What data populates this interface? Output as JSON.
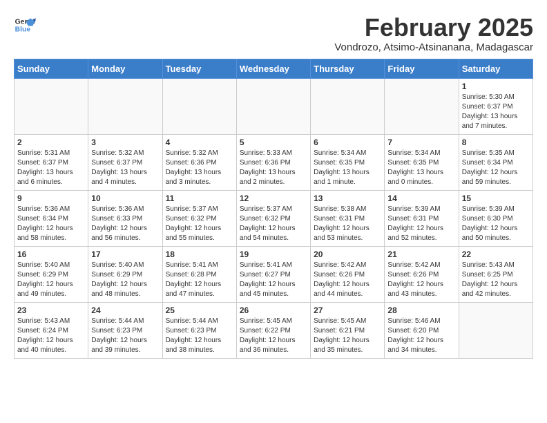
{
  "header": {
    "logo_line1": "General",
    "logo_line2": "Blue",
    "title": "February 2025",
    "subtitle": "Vondrozo, Atsimo-Atsinanana, Madagascar"
  },
  "days_of_week": [
    "Sunday",
    "Monday",
    "Tuesday",
    "Wednesday",
    "Thursday",
    "Friday",
    "Saturday"
  ],
  "weeks": [
    [
      {
        "day": "",
        "info": ""
      },
      {
        "day": "",
        "info": ""
      },
      {
        "day": "",
        "info": ""
      },
      {
        "day": "",
        "info": ""
      },
      {
        "day": "",
        "info": ""
      },
      {
        "day": "",
        "info": ""
      },
      {
        "day": "1",
        "info": "Sunrise: 5:30 AM\nSunset: 6:37 PM\nDaylight: 13 hours\nand 7 minutes."
      }
    ],
    [
      {
        "day": "2",
        "info": "Sunrise: 5:31 AM\nSunset: 6:37 PM\nDaylight: 13 hours\nand 6 minutes."
      },
      {
        "day": "3",
        "info": "Sunrise: 5:32 AM\nSunset: 6:37 PM\nDaylight: 13 hours\nand 4 minutes."
      },
      {
        "day": "4",
        "info": "Sunrise: 5:32 AM\nSunset: 6:36 PM\nDaylight: 13 hours\nand 3 minutes."
      },
      {
        "day": "5",
        "info": "Sunrise: 5:33 AM\nSunset: 6:36 PM\nDaylight: 13 hours\nand 2 minutes."
      },
      {
        "day": "6",
        "info": "Sunrise: 5:34 AM\nSunset: 6:35 PM\nDaylight: 13 hours\nand 1 minute."
      },
      {
        "day": "7",
        "info": "Sunrise: 5:34 AM\nSunset: 6:35 PM\nDaylight: 13 hours\nand 0 minutes."
      },
      {
        "day": "8",
        "info": "Sunrise: 5:35 AM\nSunset: 6:34 PM\nDaylight: 12 hours\nand 59 minutes."
      }
    ],
    [
      {
        "day": "9",
        "info": "Sunrise: 5:36 AM\nSunset: 6:34 PM\nDaylight: 12 hours\nand 58 minutes."
      },
      {
        "day": "10",
        "info": "Sunrise: 5:36 AM\nSunset: 6:33 PM\nDaylight: 12 hours\nand 56 minutes."
      },
      {
        "day": "11",
        "info": "Sunrise: 5:37 AM\nSunset: 6:32 PM\nDaylight: 12 hours\nand 55 minutes."
      },
      {
        "day": "12",
        "info": "Sunrise: 5:37 AM\nSunset: 6:32 PM\nDaylight: 12 hours\nand 54 minutes."
      },
      {
        "day": "13",
        "info": "Sunrise: 5:38 AM\nSunset: 6:31 PM\nDaylight: 12 hours\nand 53 minutes."
      },
      {
        "day": "14",
        "info": "Sunrise: 5:39 AM\nSunset: 6:31 PM\nDaylight: 12 hours\nand 52 minutes."
      },
      {
        "day": "15",
        "info": "Sunrise: 5:39 AM\nSunset: 6:30 PM\nDaylight: 12 hours\nand 50 minutes."
      }
    ],
    [
      {
        "day": "16",
        "info": "Sunrise: 5:40 AM\nSunset: 6:29 PM\nDaylight: 12 hours\nand 49 minutes."
      },
      {
        "day": "17",
        "info": "Sunrise: 5:40 AM\nSunset: 6:29 PM\nDaylight: 12 hours\nand 48 minutes."
      },
      {
        "day": "18",
        "info": "Sunrise: 5:41 AM\nSunset: 6:28 PM\nDaylight: 12 hours\nand 47 minutes."
      },
      {
        "day": "19",
        "info": "Sunrise: 5:41 AM\nSunset: 6:27 PM\nDaylight: 12 hours\nand 45 minutes."
      },
      {
        "day": "20",
        "info": "Sunrise: 5:42 AM\nSunset: 6:26 PM\nDaylight: 12 hours\nand 44 minutes."
      },
      {
        "day": "21",
        "info": "Sunrise: 5:42 AM\nSunset: 6:26 PM\nDaylight: 12 hours\nand 43 minutes."
      },
      {
        "day": "22",
        "info": "Sunrise: 5:43 AM\nSunset: 6:25 PM\nDaylight: 12 hours\nand 42 minutes."
      }
    ],
    [
      {
        "day": "23",
        "info": "Sunrise: 5:43 AM\nSunset: 6:24 PM\nDaylight: 12 hours\nand 40 minutes."
      },
      {
        "day": "24",
        "info": "Sunrise: 5:44 AM\nSunset: 6:23 PM\nDaylight: 12 hours\nand 39 minutes."
      },
      {
        "day": "25",
        "info": "Sunrise: 5:44 AM\nSunset: 6:23 PM\nDaylight: 12 hours\nand 38 minutes."
      },
      {
        "day": "26",
        "info": "Sunrise: 5:45 AM\nSunset: 6:22 PM\nDaylight: 12 hours\nand 36 minutes."
      },
      {
        "day": "27",
        "info": "Sunrise: 5:45 AM\nSunset: 6:21 PM\nDaylight: 12 hours\nand 35 minutes."
      },
      {
        "day": "28",
        "info": "Sunrise: 5:46 AM\nSunset: 6:20 PM\nDaylight: 12 hours\nand 34 minutes."
      },
      {
        "day": "",
        "info": ""
      }
    ]
  ]
}
